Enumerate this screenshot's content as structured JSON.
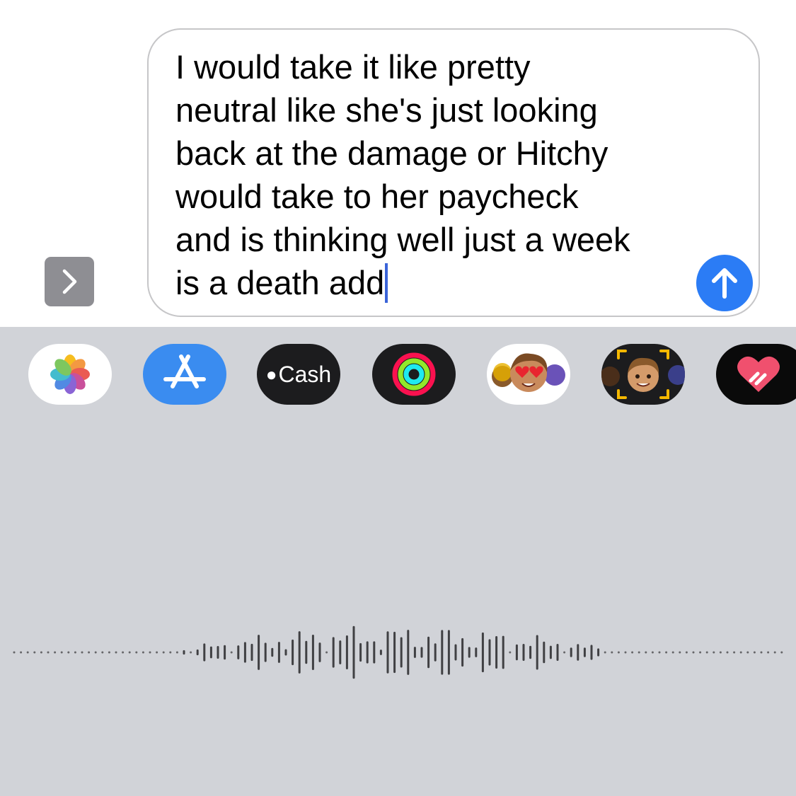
{
  "composer": {
    "message_text": "I would take it like pretty\nneutral like she's just looking\nback at the damage or Hitchy\nwould take to her paycheck\nand is thinking well just a week\nis a death add",
    "expand_icon": "chevron-right-icon",
    "send_icon": "arrow-up-icon",
    "send_color": "#2b7cf5"
  },
  "app_drawer": {
    "apps": [
      {
        "name": "Photos",
        "icon": "photos-icon"
      },
      {
        "name": "App Store",
        "icon": "app-store-icon"
      },
      {
        "name": "Cash",
        "label": "Cash",
        "icon": "apple-cash-icon"
      },
      {
        "name": "Fitness",
        "icon": "activity-rings-icon"
      },
      {
        "name": "Memoji Stickers",
        "icon": "memoji-stickers-icon"
      },
      {
        "name": "Memoji",
        "icon": "memoji-icon"
      },
      {
        "name": "Digital Touch",
        "icon": "heart-icon"
      }
    ]
  },
  "dictation": {
    "waveform_icon": "dictation-waveform"
  },
  "colors": {
    "drawer_background": "#d1d3d8",
    "caret": "#3a64d8",
    "app_store_blue": "#3a8cf0"
  }
}
